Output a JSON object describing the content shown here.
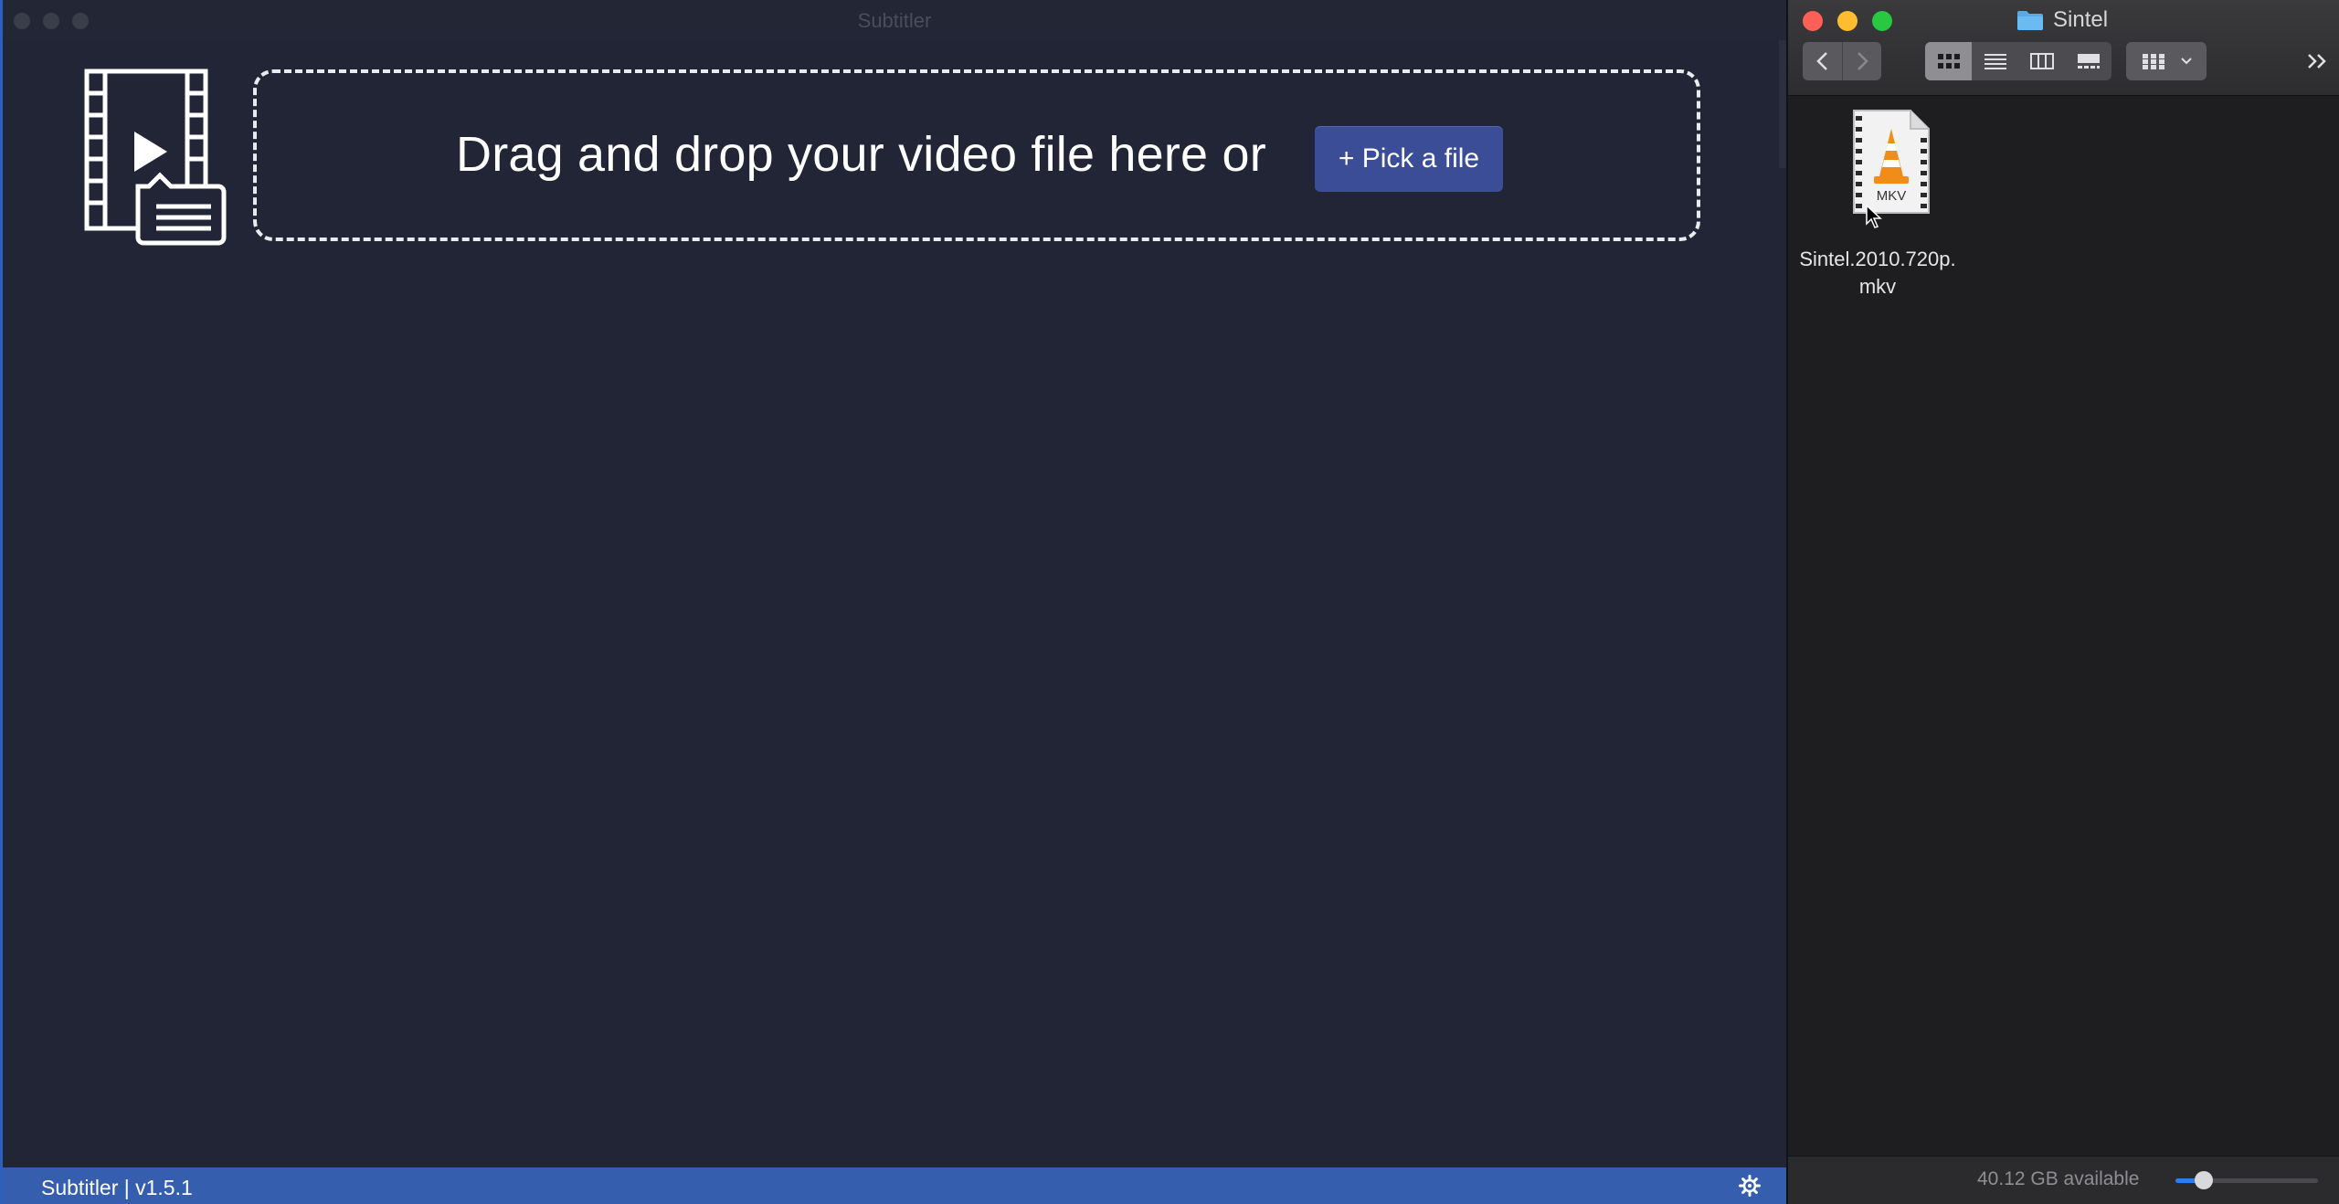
{
  "subtitler": {
    "title": "Subtitler",
    "drop_text": "Drag and drop your video file here or",
    "pick_button": "+ Pick a file",
    "status": "Subtitler | v1.5.1"
  },
  "finder": {
    "title": "Sintel",
    "file": {
      "name": "Sintel.2010.720p.mkv",
      "badge": "MKV"
    },
    "available": "40.12 GB available",
    "icon_size_fraction": 0.2
  },
  "colors": {
    "accent": "#355fae",
    "button": "#3b4d96",
    "close": "#fe5f57",
    "minimize": "#febc2e",
    "zoom": "#28c840"
  }
}
